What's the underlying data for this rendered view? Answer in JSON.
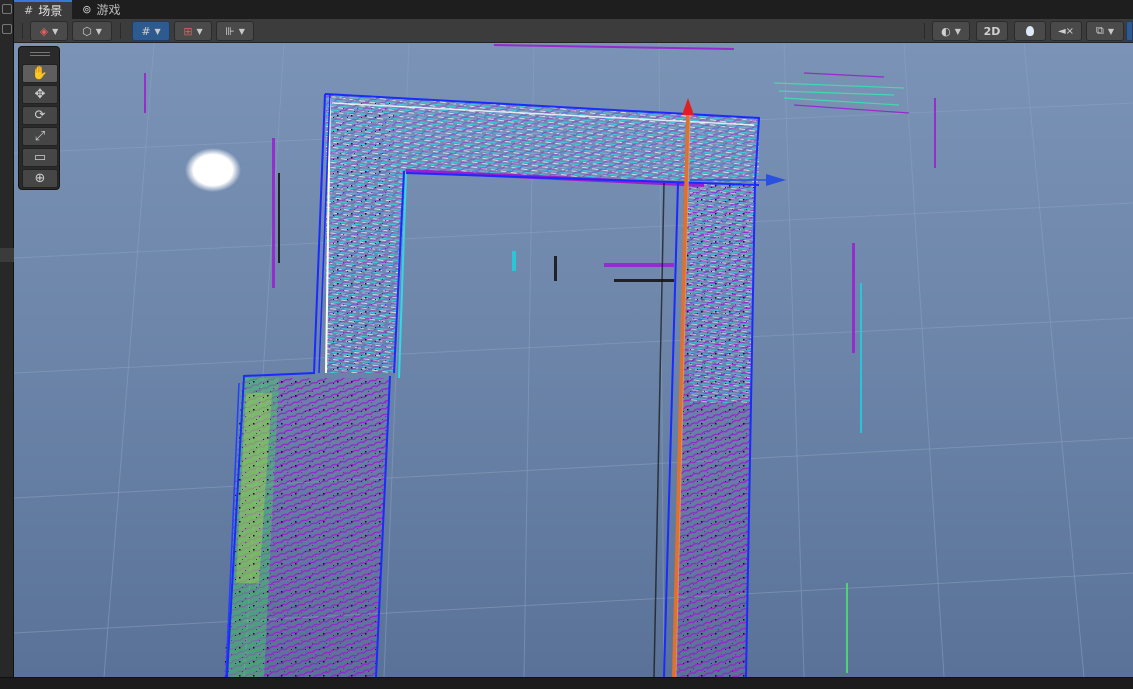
{
  "tabs": [
    {
      "label": "场景",
      "icon": "grid-icon",
      "active": true
    },
    {
      "label": "游戏",
      "icon": "gamepad-icon",
      "active": false
    }
  ],
  "toolbar": {
    "left": [
      {
        "name": "draw-mode-dropdown",
        "icon": "draw-mode-icon",
        "glyph": "◈"
      },
      {
        "name": "render-mode-dropdown",
        "icon": "cube-icon",
        "glyph": "⬡"
      },
      {
        "name": "grid-snap-toggle",
        "icon": "grid-snap-icon",
        "glyph": "#"
      },
      {
        "name": "increment-snap-dropdown",
        "icon": "increment-snap-icon",
        "glyph": "⊞"
      },
      {
        "name": "ruler-dropdown",
        "icon": "ruler-icon",
        "glyph": "⊪"
      }
    ],
    "right": [
      {
        "name": "shading-dropdown",
        "icon": "sphere-icon",
        "glyph": "◐"
      },
      {
        "name": "2d-toggle",
        "label": "2D"
      },
      {
        "name": "lighting-toggle",
        "icon": "lightbulb-icon",
        "glyph": "💡"
      },
      {
        "name": "audio-toggle",
        "icon": "audio-mute-icon",
        "glyph": "🔇"
      },
      {
        "name": "effects-dropdown",
        "icon": "layers-icon",
        "glyph": "⧉"
      }
    ]
  },
  "tools": [
    {
      "name": "hand-tool",
      "icon": "hand-icon",
      "glyph": "✋",
      "active": true
    },
    {
      "name": "move-tool",
      "icon": "move-icon",
      "glyph": "✥",
      "active": false
    },
    {
      "name": "rotate-tool",
      "icon": "rotate-icon",
      "glyph": "⟳",
      "active": false
    },
    {
      "name": "scale-tool",
      "icon": "scale-icon",
      "glyph": "⤢",
      "active": false
    },
    {
      "name": "rect-tool",
      "icon": "rect-icon",
      "glyph": "▭",
      "active": false
    },
    {
      "name": "transform-tool",
      "icon": "transform-icon",
      "glyph": "⊕",
      "active": false
    }
  ],
  "colors": {
    "selection_outline": "#1a2bff",
    "gizmo_y": "#e02020",
    "gizmo_x": "#2a50e0",
    "gizmo_z": "#e07030",
    "point_cloud_primary": "#9a1fd0",
    "point_cloud_secondary": "#20d0e0",
    "sky": "#7a93b6"
  }
}
